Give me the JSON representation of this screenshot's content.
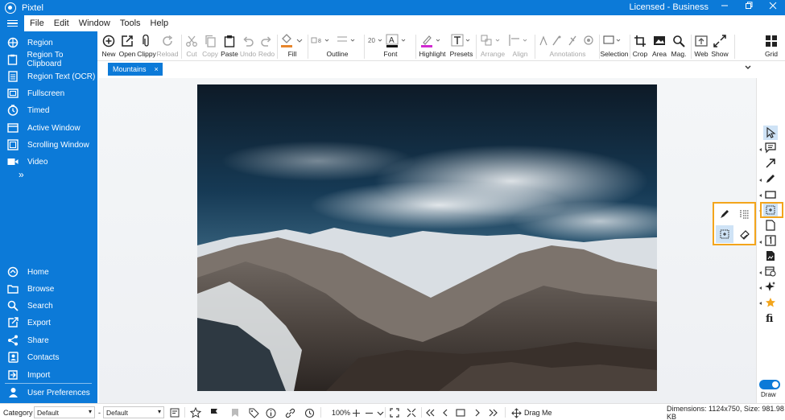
{
  "app": {
    "title": "Pixtel",
    "license": "Licensed - Business"
  },
  "window_controls": [
    "minimize",
    "restore",
    "close"
  ],
  "menu": [
    "File",
    "Edit",
    "Window",
    "Tools",
    "Help"
  ],
  "sidebar": {
    "capture_items": [
      {
        "label": "Region",
        "icon": "crosshair-icon"
      },
      {
        "label": "Region To Clipboard",
        "icon": "clipboard-icon"
      },
      {
        "label": "Region Text (OCR)",
        "icon": "document-text-icon"
      },
      {
        "label": "Fullscreen",
        "icon": "fullscreen-icon"
      },
      {
        "label": "Timed",
        "icon": "timer-icon"
      },
      {
        "label": "Active Window",
        "icon": "window-icon"
      },
      {
        "label": "Scrolling Window",
        "icon": "scroll-window-icon"
      },
      {
        "label": "Video",
        "icon": "video-camera-icon"
      }
    ],
    "more": "»",
    "bottom_items": [
      {
        "label": "Home",
        "icon": "home-icon"
      },
      {
        "label": "Browse",
        "icon": "folder-icon"
      },
      {
        "label": "Search",
        "icon": "search-icon"
      },
      {
        "label": "Export",
        "icon": "export-icon"
      },
      {
        "label": "Share",
        "icon": "share-icon"
      },
      {
        "label": "Contacts",
        "icon": "contacts-icon"
      },
      {
        "label": "Import",
        "icon": "import-icon"
      },
      {
        "label": "User Preferences",
        "icon": "user-icon"
      }
    ]
  },
  "toolbar": {
    "new": "New",
    "open": "Open",
    "clippy": "Clippy",
    "reload": "Reload",
    "cut": "Cut",
    "copy": "Copy",
    "paste": "Paste",
    "undo": "Undo",
    "redo": "Redo",
    "fill": "Fill",
    "outline": "Outline",
    "outline_size": "8",
    "font": "Font",
    "font_size": "20",
    "highlight": "Highlight",
    "presets": "Presets",
    "arrange": "Arrange",
    "align": "Align",
    "annotations": "Annotations",
    "selection": "Selection",
    "crop": "Crop",
    "area": "Area",
    "mag": "Mag.",
    "web": "Web",
    "show": "Show",
    "grid": "Grid",
    "fill_color": "#e8862c",
    "highlight_color": "#d12bd1",
    "font_color": "#111111"
  },
  "tab": {
    "label": "Mountains",
    "close": "×"
  },
  "draw": {
    "label": "Draw",
    "enabled": true
  },
  "bottom": {
    "category_label": "Category",
    "category_value": "Default",
    "dash": "-",
    "subcategory_value": "Default",
    "zoom": "100%",
    "drag_me": "Drag Me",
    "dimensions": "Dimensions: 1124x750, Size: 981.98 KB"
  },
  "colors": {
    "accent": "#0c7ad8",
    "highlight_border": "#f3a51c",
    "selected_tool": "#cfe3f6"
  }
}
